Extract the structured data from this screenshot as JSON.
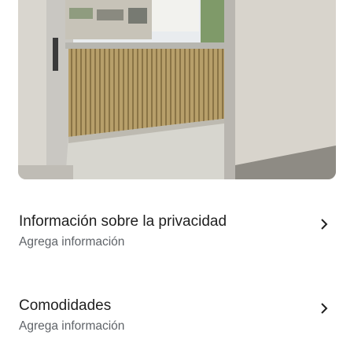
{
  "photo": {
    "icon": "balcony-photo"
  },
  "sections": [
    {
      "title": "Información sobre la privacidad",
      "subtitle": "Agrega información",
      "icon": "chevron-right-icon"
    },
    {
      "title": "Comodidades",
      "subtitle": "Agrega información",
      "icon": "chevron-right-icon"
    }
  ]
}
